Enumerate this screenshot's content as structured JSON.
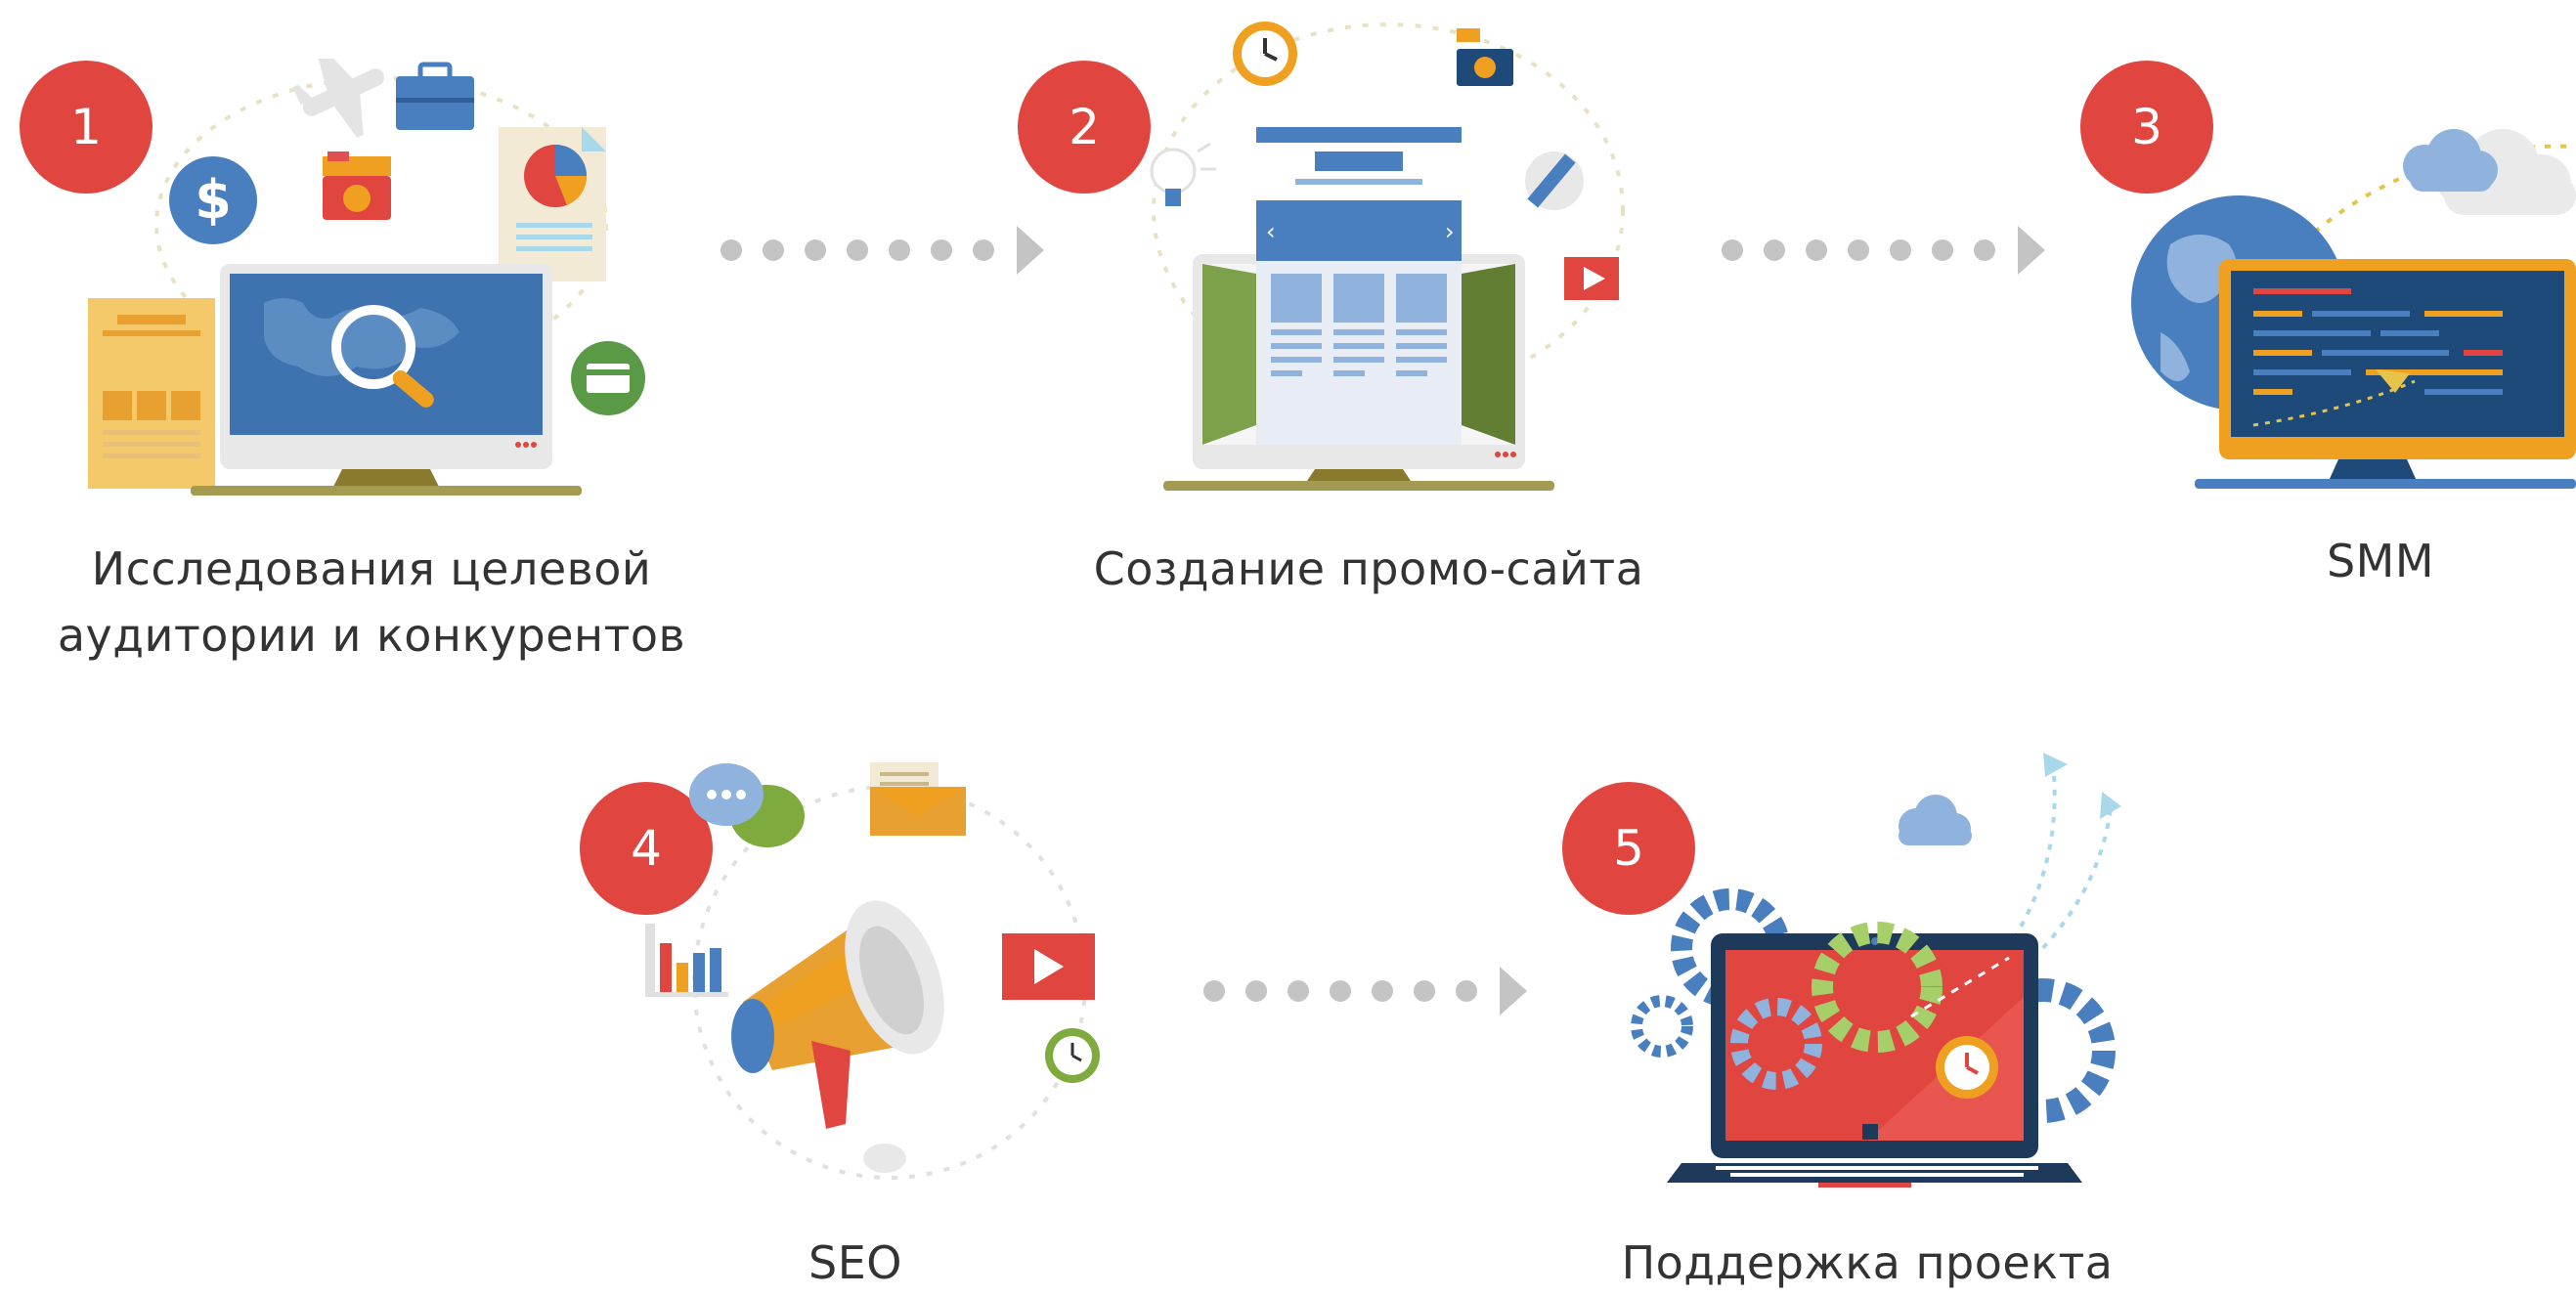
{
  "colors": {
    "badge": "#e0463f",
    "caption": "#333333",
    "arrow": "#c4c4c4"
  },
  "steps": [
    {
      "number": "1",
      "caption_lines": [
        "Исследования целевой",
        "аудитории и конкурентов"
      ],
      "icon": "monitor-with-magnifier-icon"
    },
    {
      "number": "2",
      "caption_lines": [
        "Создание промо-сайта"
      ],
      "icon": "monitor-with-website-layout-icon"
    },
    {
      "number": "3",
      "caption_lines": [
        "SMM"
      ],
      "icon": "globe-and-monitor-icon"
    },
    {
      "number": "4",
      "caption_lines": [
        "SEO"
      ],
      "icon": "megaphone-icon"
    },
    {
      "number": "5",
      "caption_lines": [
        "Поддержка проекта"
      ],
      "icon": "laptop-with-gears-icon"
    }
  ]
}
